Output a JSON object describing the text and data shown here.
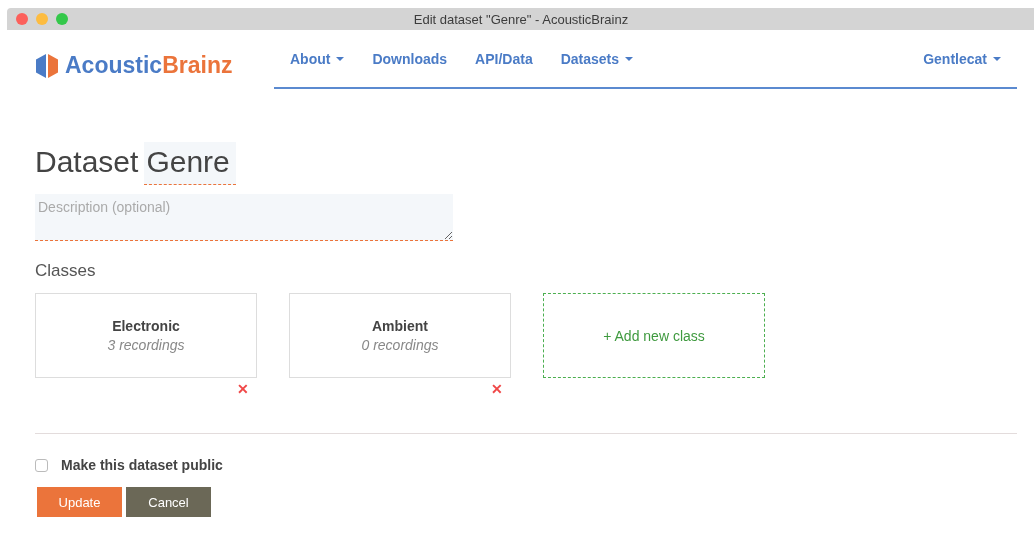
{
  "window": {
    "title": "Edit dataset \"Genre\" - AcousticBrainz"
  },
  "logo": {
    "part_1": "Acoustic",
    "part_2": "Brainz"
  },
  "nav": [
    {
      "label": "About",
      "dropdown": true
    },
    {
      "label": "Downloads",
      "dropdown": false
    },
    {
      "label": "API/Data",
      "dropdown": false
    },
    {
      "label": "Datasets",
      "dropdown": true
    }
  ],
  "user_menu": {
    "label": "Gentlecat",
    "dropdown": true
  },
  "heading": {
    "prefix": "Dataset",
    "name": "Genre"
  },
  "description": {
    "placeholder": "Description (optional)"
  },
  "classes_label": "Classes",
  "classes": [
    {
      "name": "Electronic",
      "count": "3 recordings",
      "remove": "✕"
    },
    {
      "name": "Ambient",
      "count": "0 recordings",
      "remove": "✕"
    }
  ],
  "add_class": "+ Add new class",
  "public": {
    "label": "Make this dataset public",
    "checked": false
  },
  "buttons": [
    {
      "label": "Update",
      "kind": "primary"
    },
    {
      "label": "Cancel",
      "kind": "secondary"
    }
  ]
}
